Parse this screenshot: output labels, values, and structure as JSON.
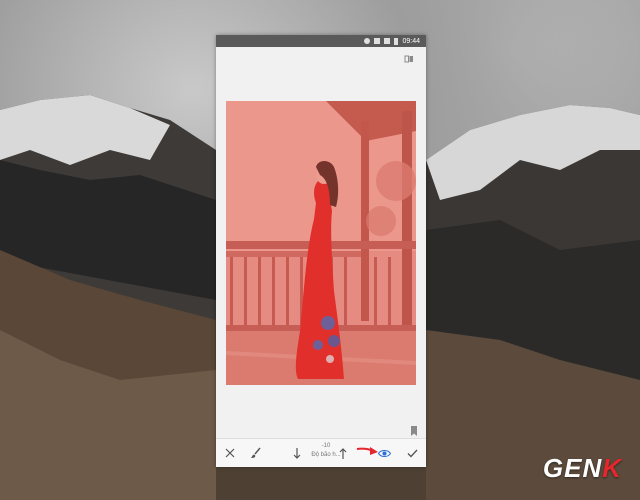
{
  "statusbar": {
    "time": "09:44",
    "icons": [
      "notification-icon",
      "wifi-icon",
      "signal-icon",
      "battery-icon"
    ]
  },
  "toolbar": {
    "compare_icon": "compare-icon",
    "bookmark_icon": "bookmark-icon"
  },
  "bottom_bar": {
    "close_icon": "close-icon",
    "brush_icon": "brush-icon",
    "decrease_icon": "arrow-down-icon",
    "adjustment_value": "-10",
    "adjustment_label": "Độ bão h...",
    "increase_icon": "arrow-up-icon",
    "mask_view_icon": "eye-icon",
    "apply_icon": "checkmark-icon"
  },
  "annotation": {
    "arrow_color": "#e6262d"
  },
  "watermark": {
    "text_main": "GEN",
    "text_accent": "K",
    "accent_color": "#e6262d"
  },
  "colors": {
    "mask_overlay": "#e25a4e",
    "dress": "#e01b1b"
  }
}
